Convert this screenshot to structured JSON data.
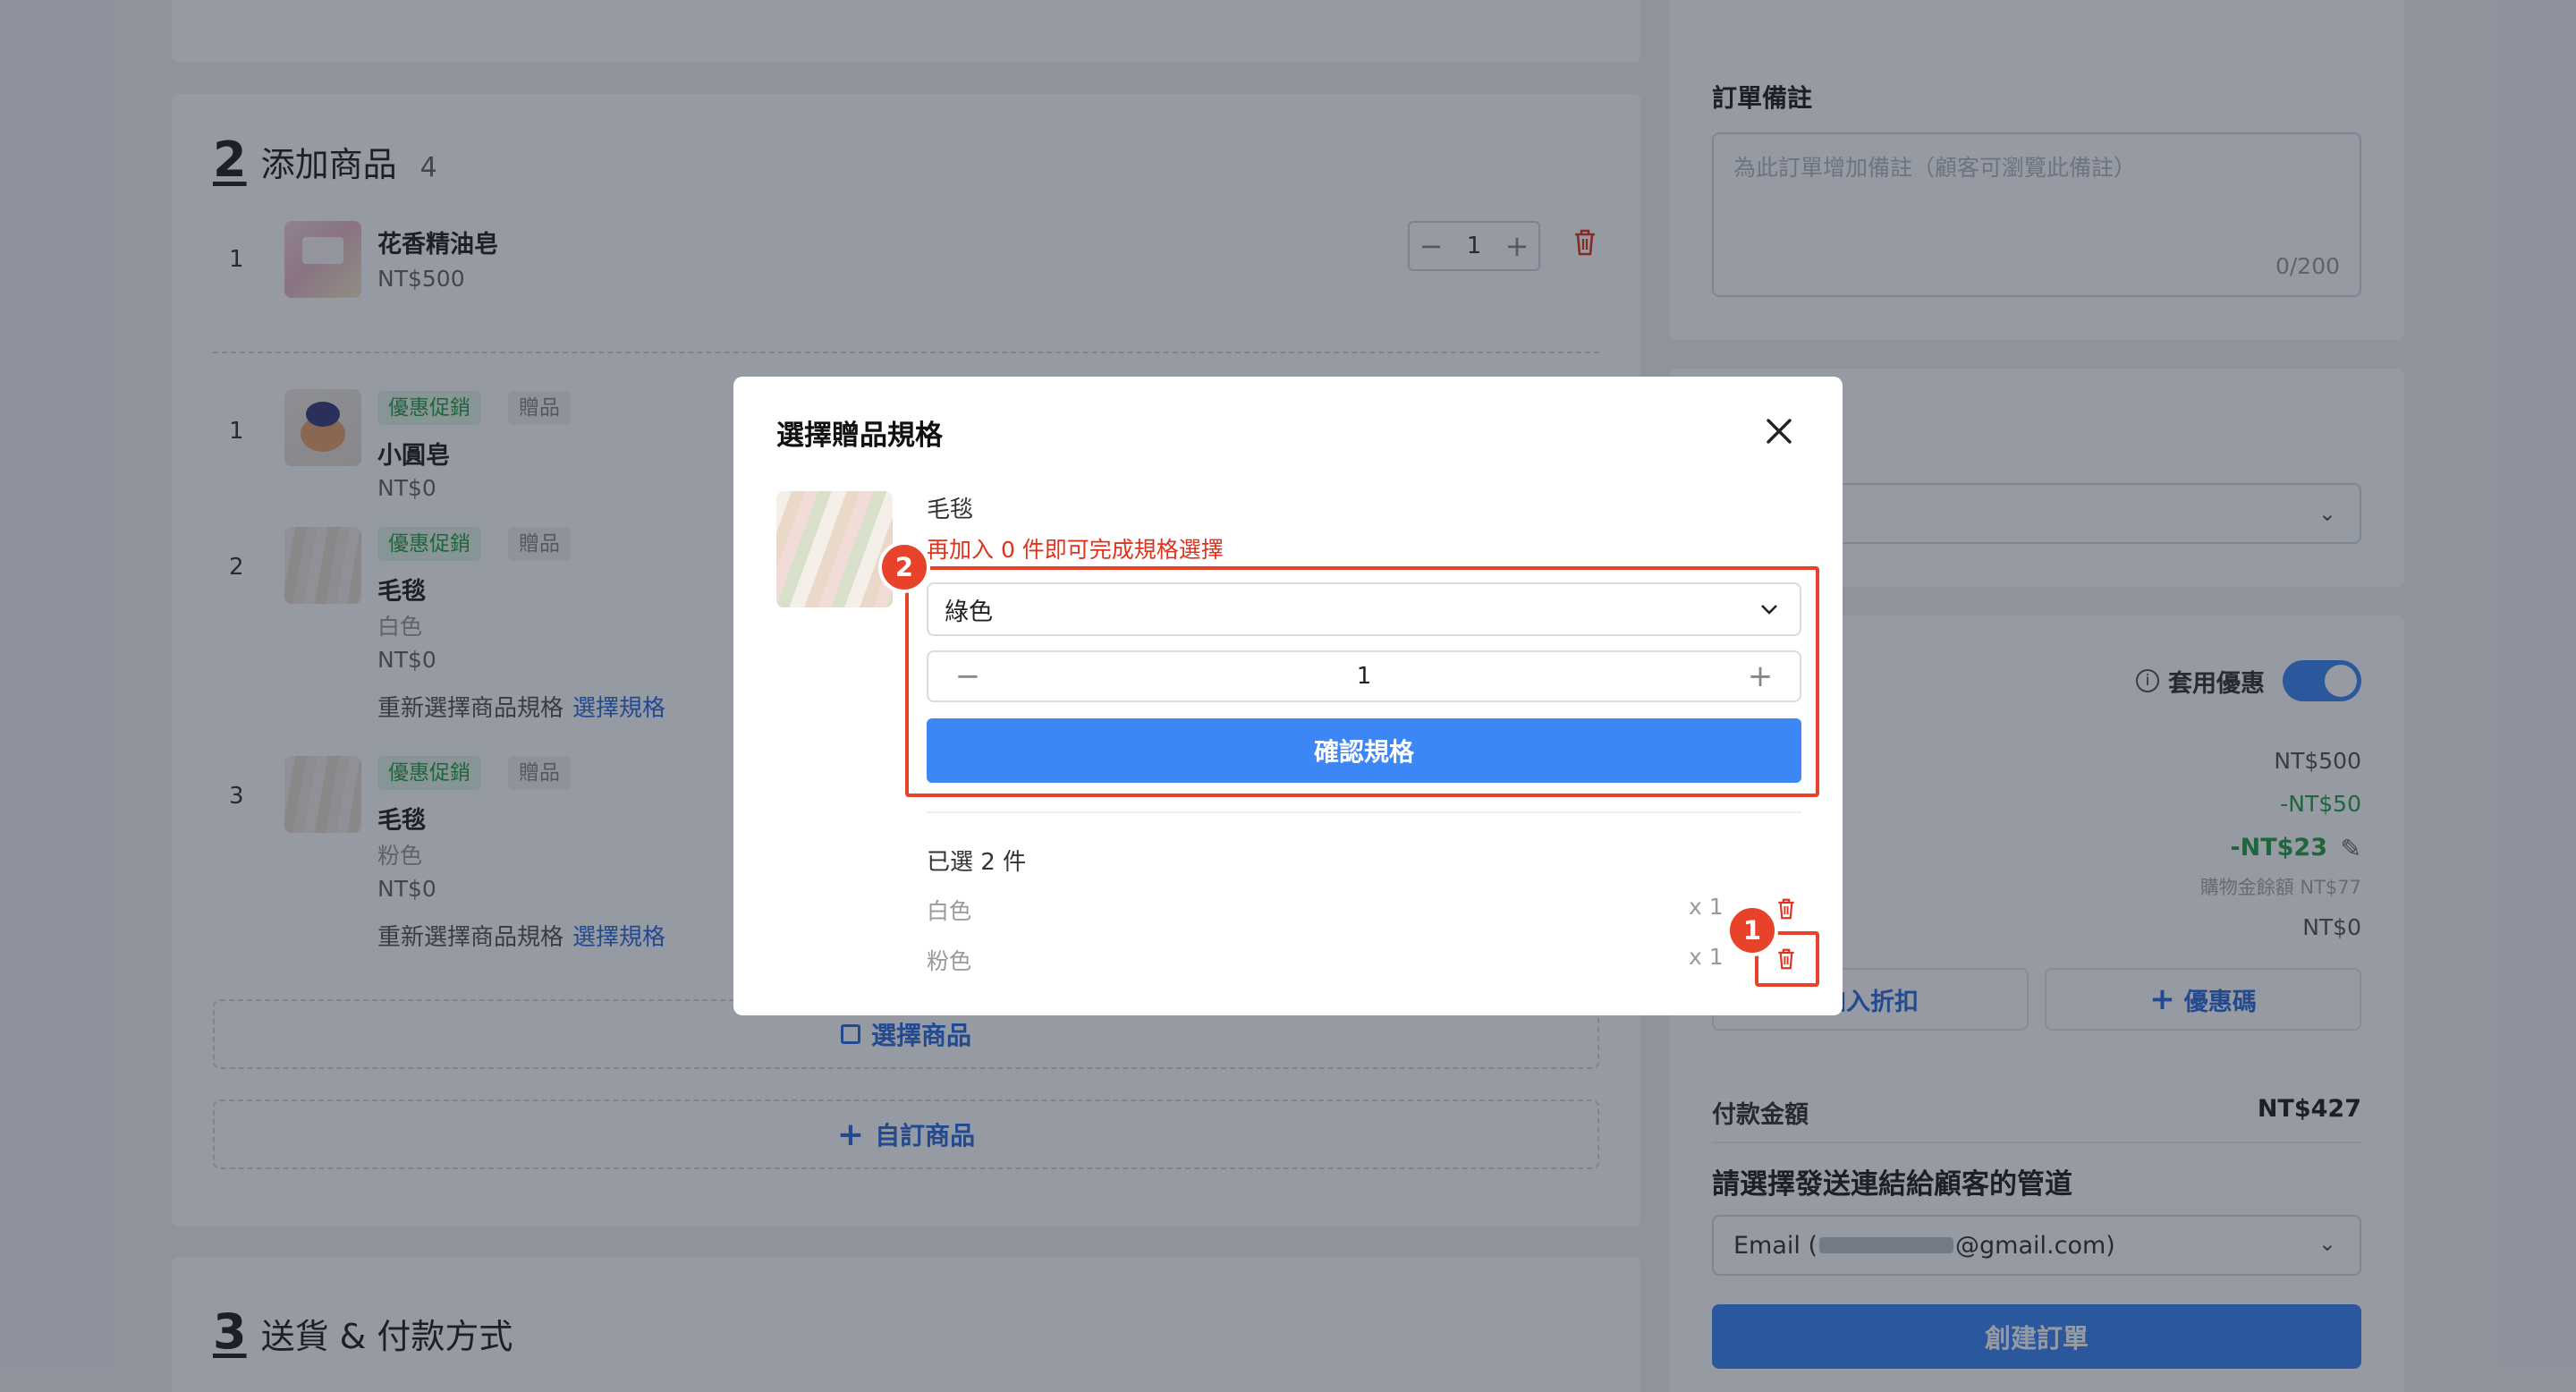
{
  "section2": {
    "number": "2",
    "title": "添加商品",
    "count": "4",
    "main_item": {
      "index": "1",
      "name": "花香精油皂",
      "price": "NT$500",
      "qty": "1"
    },
    "gifts": [
      {
        "index": "1",
        "tag_promo": "優惠促銷",
        "tag_gift": "贈品",
        "name": "小圓皂",
        "variant": "",
        "price": "NT$0"
      },
      {
        "index": "2",
        "tag_promo": "優惠促銷",
        "tag_gift": "贈品",
        "name": "毛毯",
        "variant": "白色",
        "price": "NT$0",
        "reselect_text": "重新選擇商品規格",
        "reselect_link": "選擇規格"
      },
      {
        "index": "3",
        "tag_promo": "優惠促銷",
        "tag_gift": "贈品",
        "name": "毛毯",
        "variant": "粉色",
        "price": "NT$0",
        "reselect_text": "重新選擇商品規格",
        "reselect_link": "選擇規格"
      }
    ],
    "select_products": "選擇商品",
    "custom_product": "自訂商品"
  },
  "section3": {
    "number": "3",
    "title": "送貨 & 付款方式"
  },
  "order_note": {
    "label": "訂單備註",
    "placeholder": "為此訂單增加備註（顧客可瀏覽此備註）",
    "counter": "0/200"
  },
  "summary": {
    "apply_discount_label": "套用優惠",
    "subtotal": "NT$500",
    "discount1": "-NT$50",
    "discount2": "-NT$23",
    "credit_note": "購物金餘額 NT$77",
    "shipping": "NT$0",
    "add_discount_btn": "加入折扣",
    "coupon_btn": "優惠碼",
    "payment_label": "付款金額",
    "payment_value": "NT$427",
    "channel_label": "請選擇發送連結給顧客的管道",
    "channel_prefix": "Email (",
    "channel_suffix": "@gmail.com)",
    "create_btn": "創建訂單"
  },
  "modal": {
    "title": "選擇贈品規格",
    "product_name": "毛毯",
    "warning": "再加入 0 件即可完成規格選擇",
    "selected_option": "綠色",
    "qty": "1",
    "confirm_btn": "確認規格",
    "selected_summary": "已選 2 件",
    "selected_items": [
      {
        "name": "白色",
        "qty": "x 1"
      },
      {
        "name": "粉色",
        "qty": "x 1"
      }
    ],
    "badge1": "1",
    "badge2": "2"
  },
  "colors": {
    "accent": "#3d86f5",
    "danger": "#e0331e",
    "promo": "#27a046",
    "annotation": "#e8432a"
  }
}
